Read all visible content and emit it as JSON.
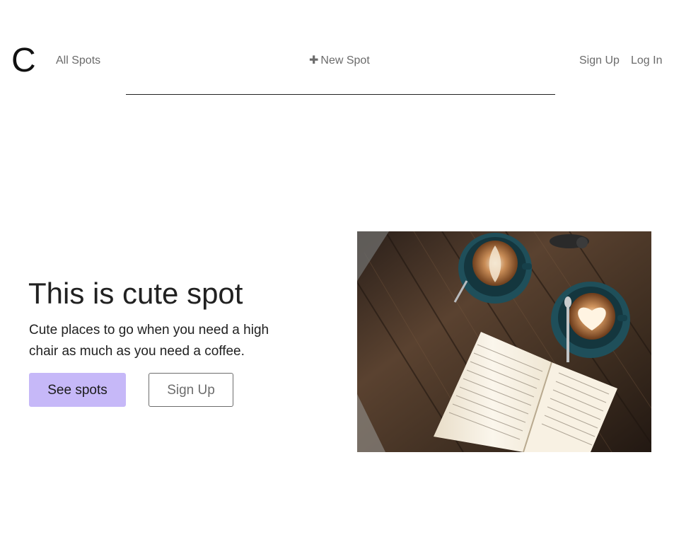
{
  "nav": {
    "logo": "C",
    "all_spots": "All Spots",
    "new_spot_icon": "plus-icon",
    "new_spot_plus": "✚",
    "new_spot": "New Spot",
    "sign_up": "Sign Up",
    "log_in": "Log In"
  },
  "hero": {
    "title": "This is cute spot",
    "lead": "Cute places to go when you need a high chair as much as you need a coffee.",
    "primary_button": "See spots",
    "secondary_button": "Sign Up",
    "image_subject": "coffee-and-book-photo"
  },
  "colors": {
    "primary_button_bg": "#c6b8f8",
    "text": "#212121",
    "nav_link": "#6b6b6b"
  }
}
